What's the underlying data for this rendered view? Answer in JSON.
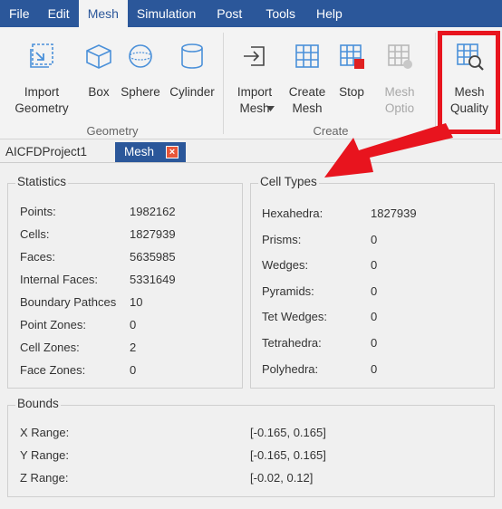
{
  "menu": [
    "File",
    "Edit",
    "Mesh",
    "Simulation",
    "Post",
    "Tools",
    "Help"
  ],
  "active_menu": "Mesh",
  "ribbon": {
    "buttons": {
      "import_geometry": "Import\nGeometry",
      "box": "Box",
      "sphere": "Sphere",
      "cylinder": "Cylinder",
      "import_mesh": "Import\nMesh",
      "create_mesh": "Create\nMesh",
      "stop": "Stop",
      "mesh_options": "Mesh\nOptio",
      "mesh_quality": "Mesh\nQuality"
    },
    "groups": {
      "geometry": "Geometry",
      "create": "Create"
    },
    "accent": "#2b579a",
    "highlight": "#e8141e"
  },
  "tabs": {
    "project": "AICFDProject1",
    "mesh": "Mesh",
    "close": "×"
  },
  "statistics": {
    "title": "Statistics",
    "rows": [
      {
        "label": "Points:",
        "value": "1982162"
      },
      {
        "label": "Cells:",
        "value": "1827939"
      },
      {
        "label": "Faces:",
        "value": "5635985"
      },
      {
        "label": "Internal Faces:",
        "value": "5331649"
      },
      {
        "label": "Boundary Pathces",
        "value": "10"
      },
      {
        "label": "Point Zones:",
        "value": "0"
      },
      {
        "label": "Cell Zones:",
        "value": "2"
      },
      {
        "label": "Face Zones:",
        "value": "0"
      }
    ]
  },
  "cell_types": {
    "title": "Cell Types",
    "rows": [
      {
        "label": "Hexahedra:",
        "value": "1827939"
      },
      {
        "label": "Prisms:",
        "value": "0"
      },
      {
        "label": "Wedges:",
        "value": "0"
      },
      {
        "label": "Pyramids:",
        "value": "0"
      },
      {
        "label": "Tet Wedges:",
        "value": "0"
      },
      {
        "label": "Tetrahedra:",
        "value": "0"
      },
      {
        "label": "Polyhedra:",
        "value": "0"
      }
    ]
  },
  "bounds": {
    "title": "Bounds",
    "rows": [
      {
        "label": "X Range:",
        "value": "[-0.165, 0.165]"
      },
      {
        "label": "Y Range:",
        "value": "[-0.165, 0.165]"
      },
      {
        "label": "Z Range:",
        "value": "[-0.02, 0.12]"
      }
    ]
  }
}
